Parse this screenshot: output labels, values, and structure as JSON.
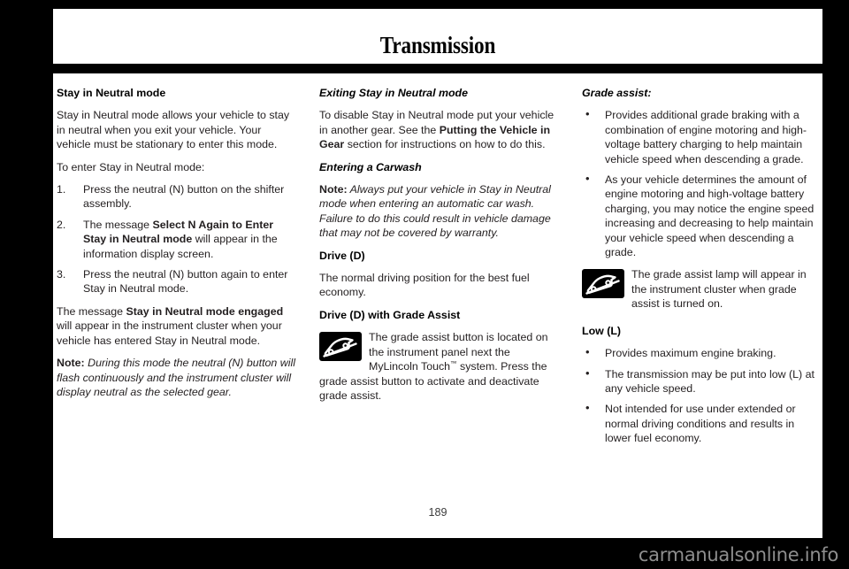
{
  "header": {
    "title": "Transmission"
  },
  "page_number": "189",
  "watermark": "carmanualsonline.info",
  "icons": {
    "grade_assist_name": "grade-assist-icon",
    "background": "#000000",
    "glyph": "#ffffff"
  },
  "column1": {
    "heading": "Stay in Neutral mode",
    "para1": "Stay in Neutral mode allows your vehicle to stay in neutral when you exit your vehicle. Your vehicle must be stationary to enter this mode.",
    "para2": "To enter Stay in Neutral mode:",
    "steps": [
      {
        "num": "1.",
        "text": "Press the neutral (N) button on the shifter assembly."
      },
      {
        "num": "2.",
        "pre": "The message ",
        "bold": "Select N Again to Enter Stay in Neutral mode",
        "post": " will appear in the information display screen."
      },
      {
        "num": "3.",
        "text": "Press the neutral (N) button again to enter Stay in Neutral mode."
      }
    ],
    "para3_pre": "The message ",
    "para3_bold": "Stay in Neutral mode engaged",
    "para3_post": " will appear in the instrument cluster when your vehicle has entered Stay in Neutral mode.",
    "note_label": "Note:",
    "note_text": " During this mode the neutral (N) button will flash continuously and the instrument cluster will display neutral as the selected gear."
  },
  "column2": {
    "heading1": "Exiting Stay in Neutral mode",
    "para1_pre": "To disable Stay in Neutral mode put your vehicle in another gear. See the ",
    "para1_bold": "Putting the Vehicle in Gear",
    "para1_post": " section for instructions on how to do this.",
    "heading2": "Entering a Carwash",
    "note_label": "Note:",
    "note_text": " Always put your vehicle in Stay in Neutral mode when entering an automatic car wash. Failure to do this could result in vehicle damage that may not be covered by warranty.",
    "heading3": "Drive (D)",
    "para2": "The normal driving position for the best fuel economy.",
    "heading4": "Drive (D) with Grade Assist",
    "icon_para": "The grade assist button is located on the instrument panel next the MyLincoln Touch",
    "icon_para_tm": "™",
    "icon_para_rest": " system. Press the grade assist button to activate and deactivate grade assist."
  },
  "column3": {
    "heading1": "Grade assist:",
    "bullets1": [
      "Provides additional grade braking with a combination of engine motoring and high-voltage battery charging to help maintain vehicle speed when descending a grade.",
      "As your vehicle determines the amount of engine motoring and high-voltage battery charging, you may notice the engine speed increasing and decreasing to help maintain your vehicle speed when descending a grade."
    ],
    "icon_para": "The grade assist lamp will appear in the instrument cluster when grade assist is turned on.",
    "heading2": "Low (L)",
    "bullets2": [
      "Provides maximum engine braking.",
      "The transmission may be put into low (L) at any vehicle speed.",
      "Not intended for use under extended or normal driving conditions and results in lower fuel economy."
    ]
  }
}
